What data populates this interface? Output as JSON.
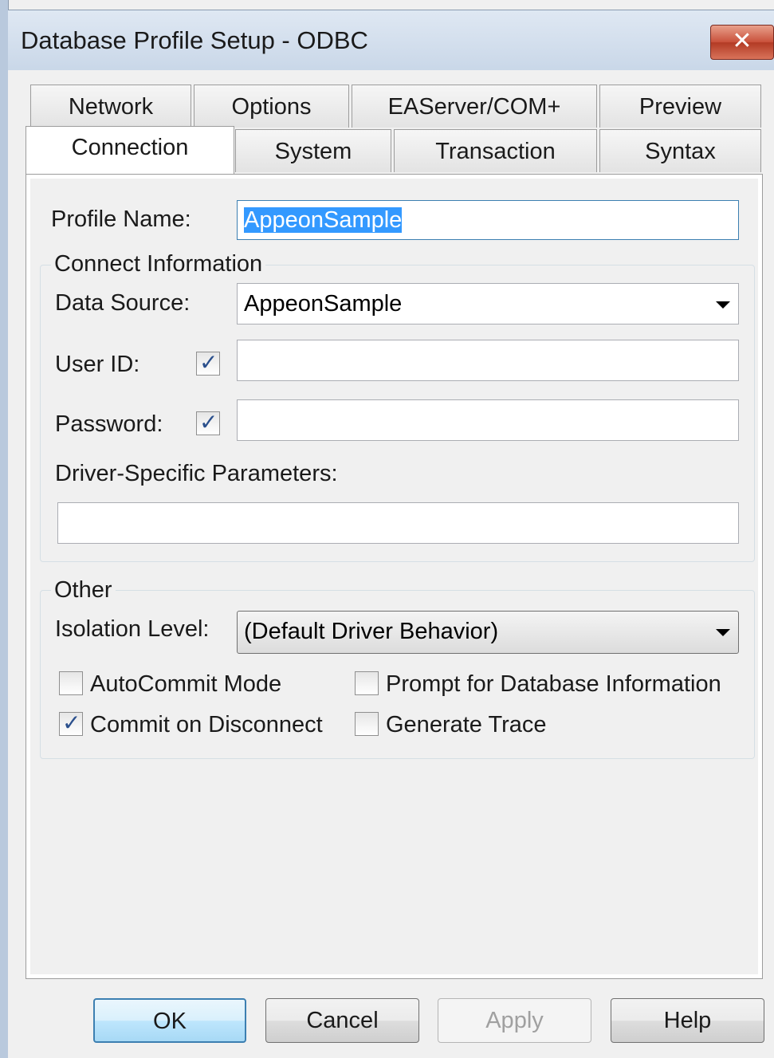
{
  "window": {
    "title": "Database Profile Setup - ODBC",
    "close_glyph": "✕"
  },
  "tabs": {
    "row_back": [
      "Network",
      "Options",
      "EAServer/COM+",
      "Preview"
    ],
    "row_front": [
      "Connection",
      "System",
      "Transaction",
      "Syntax"
    ],
    "active": "Connection"
  },
  "profile": {
    "label": "Profile Name:",
    "value": "AppeonSample"
  },
  "connect": {
    "legend": "Connect Information",
    "data_source_label": "Data Source:",
    "data_source_value": "AppeonSample",
    "user_id_label": "User ID:",
    "user_id_checked": true,
    "user_id_value": "",
    "password_label": "Password:",
    "password_checked": true,
    "password_value": "",
    "driver_params_label": "Driver-Specific Parameters:",
    "driver_params_value": ""
  },
  "other": {
    "legend": "Other",
    "isolation_label": "Isolation Level:",
    "isolation_value": "(Default Driver Behavior)",
    "autocommit_label": "AutoCommit Mode",
    "autocommit_checked": false,
    "commit_disconnect_label": "Commit on Disconnect",
    "commit_disconnect_checked": true,
    "prompt_label": "Prompt for Database Information",
    "prompt_checked": false,
    "trace_label": "Generate Trace",
    "trace_checked": false
  },
  "buttons": {
    "ok": "OK",
    "cancel": "Cancel",
    "apply": "Apply",
    "help": "Help"
  },
  "icons": {
    "checkmark": "✓"
  },
  "colors": {
    "selection": "#3399ff",
    "focus_border": "#3c7fb1"
  }
}
